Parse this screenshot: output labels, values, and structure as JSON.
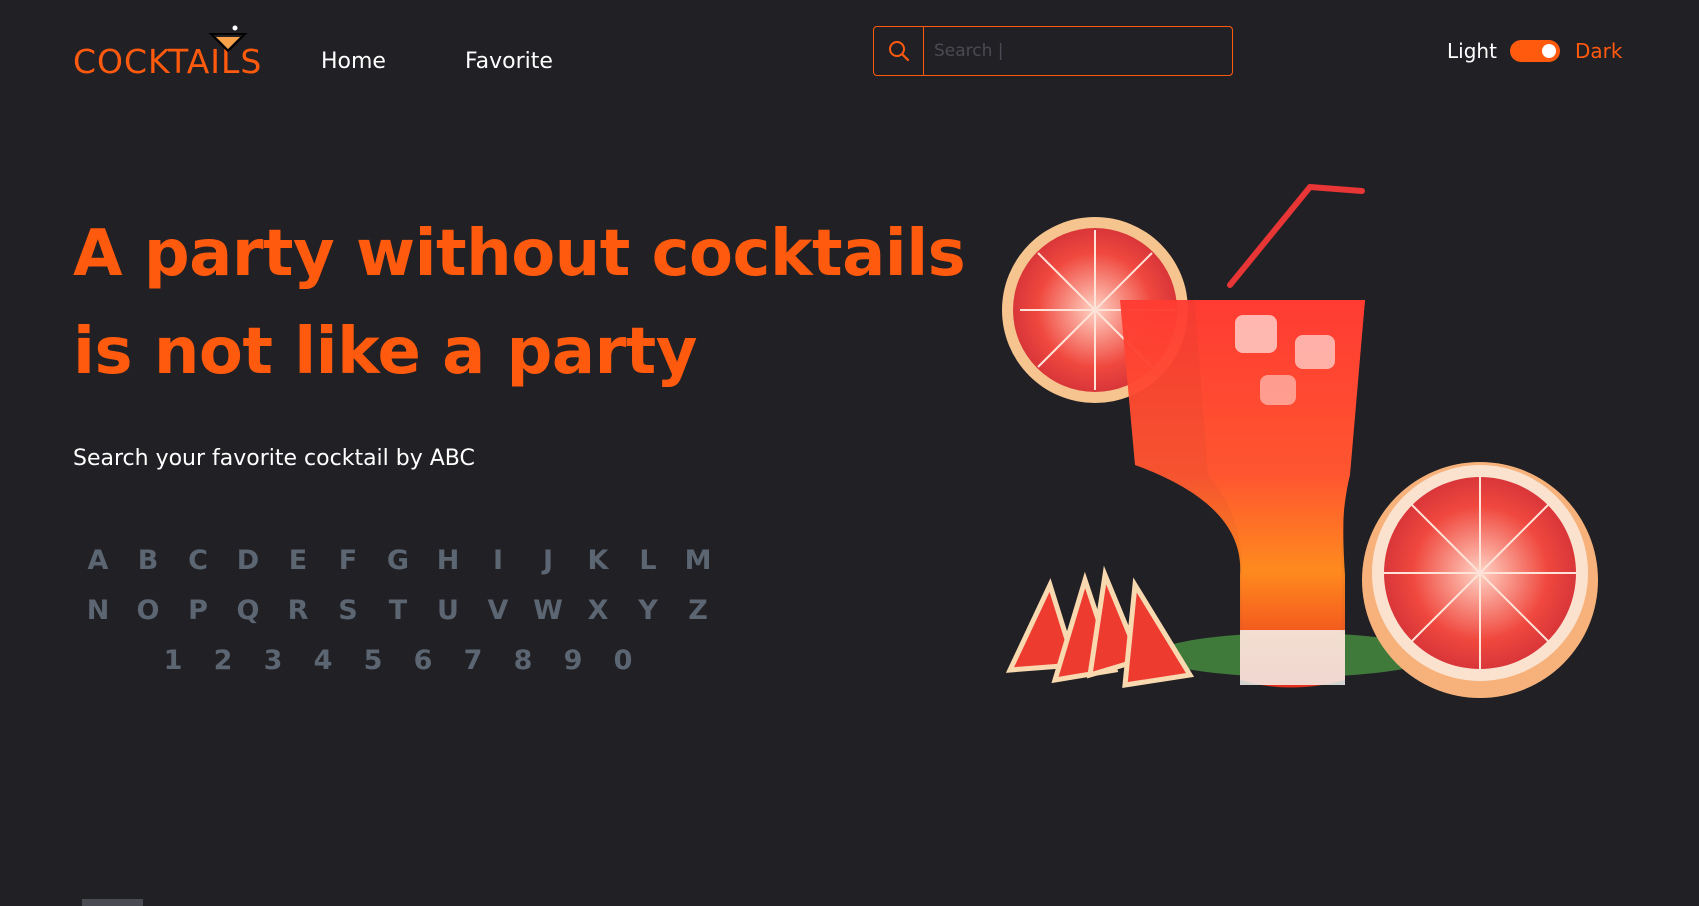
{
  "header": {
    "logo": "COCKTAILS",
    "nav": [
      {
        "label": "Home"
      },
      {
        "label": "Favorite"
      }
    ],
    "search": {
      "placeholder": "Search |",
      "value": ""
    },
    "theme": {
      "light_label": "Light",
      "dark_label": "Dark",
      "mode": "dark"
    }
  },
  "hero": {
    "title_line1": "A party without cocktails",
    "title_line2": "is not like a party",
    "subtitle": "Search your favorite cocktail by ABC",
    "image_icon": "cocktail-illustration"
  },
  "abc": {
    "row1": [
      "A",
      "B",
      "C",
      "D",
      "E",
      "F",
      "G",
      "H",
      "I",
      "J",
      "K",
      "L",
      "M"
    ],
    "row2": [
      "N",
      "O",
      "P",
      "Q",
      "R",
      "S",
      "T",
      "U",
      "V",
      "W",
      "X",
      "Y",
      "Z"
    ],
    "row3": [
      "1",
      "2",
      "3",
      "4",
      "5",
      "6",
      "7",
      "8",
      "9",
      "0"
    ]
  },
  "colors": {
    "accent": "#ff5a0e",
    "background": "#212025",
    "muted": "#5c6672"
  }
}
